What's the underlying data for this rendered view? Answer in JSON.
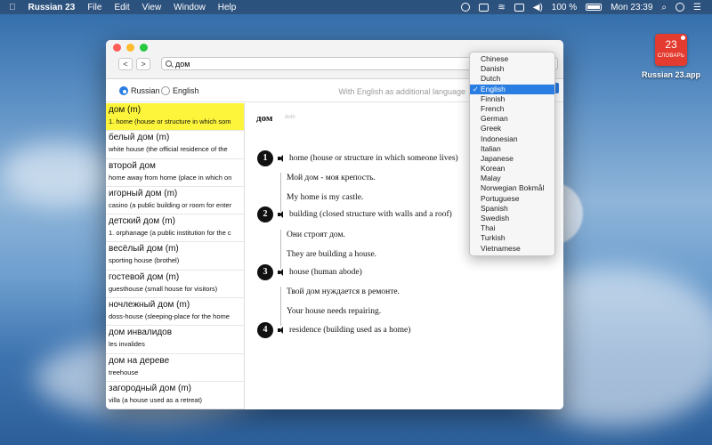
{
  "menubar": {
    "app": "Russian 23",
    "items": [
      "File",
      "Edit",
      "View",
      "Window",
      "Help"
    ],
    "battery_text": "100 %",
    "time": "Mon 23:39"
  },
  "desktop": {
    "icon_number": "23",
    "icon_word": "СЛОВАРЬ",
    "app_label": "Russian 23.app"
  },
  "toolbar": {
    "back": "<",
    "forward": ">",
    "search_value": "дом"
  },
  "language": {
    "options": [
      "Russian",
      "English"
    ],
    "selected": "Russian",
    "additional_label": "With English as additional language"
  },
  "sidebar": {
    "entries": [
      {
        "word": "дом (m)",
        "gloss": "1. home (house or structure in which som"
      },
      {
        "word": "белый дом (m)",
        "gloss": "white house (the official residence of the"
      },
      {
        "word": "второй дом",
        "gloss": "home away from home (place in which on"
      },
      {
        "word": "игорный дом (m)",
        "gloss": "casino (a public building or room for enter"
      },
      {
        "word": "детский дом (m)",
        "gloss": "1. orphanage (a public institution for the c"
      },
      {
        "word": "весёлый дом (m)",
        "gloss": "sporting house (brothel)"
      },
      {
        "word": "гостевой дом (m)",
        "gloss": "guesthouse (small house for visitors)"
      },
      {
        "word": "ночлежный дом (m)",
        "gloss": "doss-house (sleeping-place for the home"
      },
      {
        "word": "дом инвалидов",
        "gloss": "les invalides"
      },
      {
        "word": "дом на дереве",
        "gloss": "treehouse"
      },
      {
        "word": "загородный дом (m)",
        "gloss": "villa (a house used as a retreat)"
      }
    ]
  },
  "article": {
    "headword": "дом",
    "transcription": "dom",
    "senses": [
      {
        "num": "1",
        "def": "home (house or structure in which someone lives)",
        "ex_ru": "Мой дом - моя крепость.",
        "ex_en": "My home is my castle."
      },
      {
        "num": "2",
        "def": "building (closed structure with walls and a roof)",
        "ex_ru": "Они строят дом.",
        "ex_en": "They are building a house."
      },
      {
        "num": "3",
        "def": "house (human abode)",
        "ex_ru": "Твой дом нуждается в ремонте.",
        "ex_en": "Your house needs repairing."
      },
      {
        "num": "4",
        "def": "residence (building used as a home)",
        "ex_ru": "",
        "ex_en": ""
      }
    ]
  },
  "dropdown": {
    "selected": "English",
    "options": [
      "Chinese",
      "Danish",
      "Dutch",
      "English",
      "Finnish",
      "French",
      "German",
      "Greek",
      "Indonesian",
      "Italian",
      "Japanese",
      "Korean",
      "Malay",
      "Norwegian Bokmål",
      "Portuguese",
      "Spanish",
      "Swedish",
      "Thai",
      "Turkish",
      "Vietnamese"
    ]
  }
}
